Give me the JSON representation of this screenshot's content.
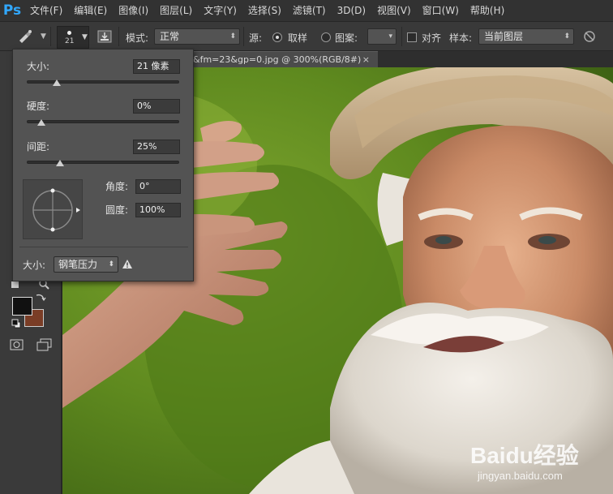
{
  "app": {
    "logo": "Ps"
  },
  "menu": [
    "文件(F)",
    "编辑(E)",
    "图像(I)",
    "图层(L)",
    "文字(Y)",
    "选择(S)",
    "滤镜(T)",
    "3D(D)",
    "视图(V)",
    "窗口(W)",
    "帮助(H)"
  ],
  "options": {
    "brush_size": "21",
    "mode_label": "模式:",
    "mode_value": "正常",
    "source_label": "源:",
    "sample_radio": "取样",
    "pattern_radio": "图案:",
    "align_label": "对齐",
    "sample_label": "样本:",
    "sample_value": "当前图层",
    "sample_radio_selected": true,
    "align_checked": false
  },
  "document": {
    "tab_title": "&fm=23&gp=0.jpg @ 300%(RGB/8#)",
    "close_symbol": "×"
  },
  "brush_popup": {
    "size_label": "大小:",
    "size_value": "21 像素",
    "hardness_label": "硬度:",
    "hardness_value": "0%",
    "spacing_label": "间距:",
    "spacing_value": "25%",
    "angle_label": "角度:",
    "angle_value": "0°",
    "roundness_label": "圆度:",
    "roundness_value": "100%",
    "pen_size_label": "大小:",
    "pen_size_option": "钢笔压力",
    "size_slider_fraction": 0.1,
    "hardness_slider_fraction": 0.0,
    "spacing_slider_fraction": 0.12
  },
  "colors": {
    "foreground": "#111111",
    "background": "#7a3d26",
    "accent_ps": "#31a8ff"
  },
  "watermark": {
    "brand": "Baidu经验",
    "url": "jingyan.baidu.com"
  }
}
